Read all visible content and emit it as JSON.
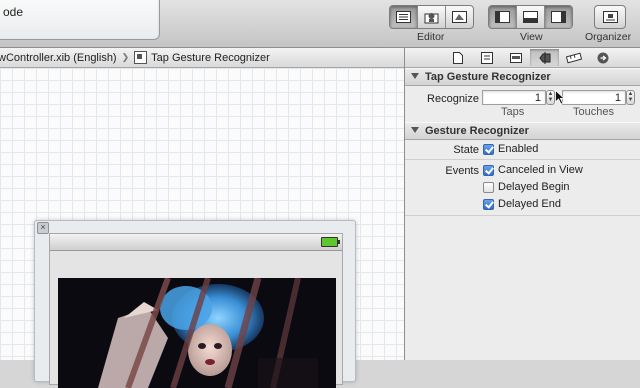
{
  "toolbar": {
    "status_text": "ode",
    "editor_label": "Editor",
    "view_label": "View",
    "organizer_label": "Organizer",
    "editor_buttons": [
      "standard-editor-icon",
      "assistant-editor-icon",
      "version-editor-icon"
    ],
    "view_buttons": [
      "navigator-pane-icon",
      "debug-area-icon",
      "utilities-pane-icon"
    ]
  },
  "jumpbar": {
    "file": "wController.xib (English)",
    "object": "Tap Gesture Recognizer"
  },
  "inspector": {
    "tabs": [
      "file-inspector-icon",
      "quick-help-icon",
      "identity-inspector-icon",
      "attributes-inspector-icon",
      "size-inspector-icon",
      "connections-inspector-icon"
    ],
    "tap_section": {
      "title": "Tap Gesture Recognizer",
      "recognize_label": "Recognize",
      "taps_value": "1",
      "touches_value": "1",
      "taps_label": "Taps",
      "touches_label": "Touches"
    },
    "gesture_section": {
      "title": "Gesture Recognizer",
      "state_label": "State",
      "enabled_label": "Enabled",
      "events_label": "Events",
      "events": [
        {
          "label": "Canceled in View",
          "checked": true
        },
        {
          "label": "Delayed Begin",
          "checked": false
        },
        {
          "label": "Delayed End",
          "checked": true
        }
      ]
    }
  },
  "colors": {
    "checkbox_accent": "#2f6fcf",
    "battery": "#5cc72e"
  }
}
